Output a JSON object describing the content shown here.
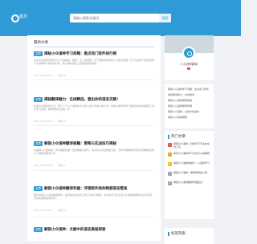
{
  "header": {
    "home": "首页",
    "search_placeholder": "请输入搜索关键词",
    "search_button": "搜索"
  },
  "main": {
    "title": "最新文章",
    "badge": "文章",
    "articles": [
      {
        "title": "揭秘小众语种学习奇趣：盘点热门软件排行榜",
        "text": "在多元化的世界里学习小众语种是一趟独一无二的旅程，为了帮助你更好地入门我们整理了当下最受学习者欢迎的小众语种学习软件排行榜，助力你的语言之旅更加轻松愉快……",
        "date": "2024-10-10 02:01",
        "views": "阅读 48"
      },
      {
        "title": "揭秘翻译魅力：在线精选，激出你的语言天赋！",
        "text": "在信息全球化的今天，学习一门小众语种成为许多人提升竞争力的方式，本篇文章将带你了解优秀的在线翻译工具与学习资源，助你轻松迈出第一步……",
        "date": "2024-10-10 01:42",
        "views": "阅读 39"
      },
      {
        "title": "解锁小众语种翻译秘籍：策略与实战技巧揭秘",
        "text": "在翻译小众语种时，我们需要掌握一定的策略与技巧，本文将从实战角度出发，为你详细解析如何高效准确地完成小众语种的翻译工作……",
        "date": "2024-10-10 01:30",
        "views": "阅读 27"
      },
      {
        "title": "解锁小众语种翻译利器：评测软件助你跨越语言壁垒",
        "text": "面对市面上众多的翻译软件，如何挑选适合自己的工具成为难题，本文将对几款主流小众语种翻译软件进行评测，为你的选择提供参考……",
        "date": "2024-10-10 01:12",
        "views": "阅读 33"
      },
      {
        "title": "解锁小众语种：文献中的语言奥秘探索",
        "text": "",
        "date": "",
        "views": ""
      }
    ]
  },
  "sidebar": {
    "profile_name": "小众语种翻译",
    "links": [
      "解锁小众语种学习奇趣：盘点热门软件",
      "揭秘翻译魅力：在线精选",
      "解锁小众语种翻译秘籍",
      "解锁小众语种翻译利器",
      "解锁小众语种：文献中的语言",
      "揭秘小众语种翻译"
    ],
    "hot_title": "热门文章",
    "hot": [
      "解锁小众语种，轻松学习专业的在线工具",
      "探索小众语种学习方法与心得推荐",
      "揭秘小众语种的魅力：从语言学习",
      "解锁小众语种：翻译的那些小事",
      "解锁小众语种翻译利器盘点"
    ],
    "hot_colors": [
      "#e84c3d",
      "#f39c12",
      "#f1c40f",
      "#95a5a6",
      "#95a5a6"
    ],
    "tags_title": "标签列表"
  }
}
